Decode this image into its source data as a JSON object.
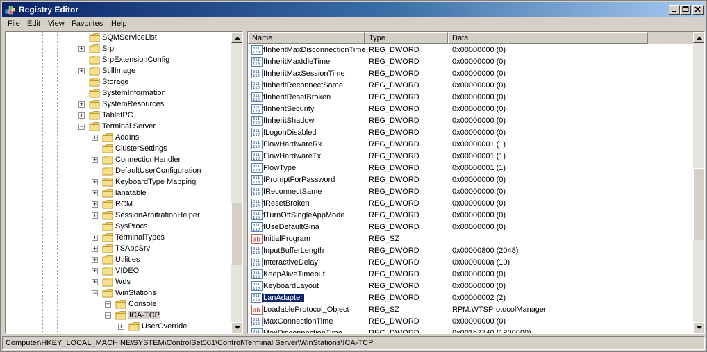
{
  "window": {
    "title": "Registry Editor"
  },
  "menu": [
    "File",
    "Edit",
    "View",
    "Favorites",
    "Help"
  ],
  "tree": [
    {
      "label": "SQMServiceList",
      "level": 0,
      "expander": "none"
    },
    {
      "label": "Srp",
      "level": 0,
      "expander": "plus"
    },
    {
      "label": "SrpExtensionConfig",
      "level": 0,
      "expander": "none"
    },
    {
      "label": "StillImage",
      "level": 0,
      "expander": "plus"
    },
    {
      "label": "Storage",
      "level": 0,
      "expander": "none"
    },
    {
      "label": "SystemInformation",
      "level": 0,
      "expander": "none"
    },
    {
      "label": "SystemResources",
      "level": 0,
      "expander": "plus"
    },
    {
      "label": "TabletPC",
      "level": 0,
      "expander": "plus"
    },
    {
      "label": "Terminal Server",
      "level": 0,
      "expander": "minus"
    },
    {
      "label": "AddIns",
      "level": 1,
      "expander": "plus"
    },
    {
      "label": "ClusterSettings",
      "level": 1,
      "expander": "none"
    },
    {
      "label": "ConnectionHandler",
      "level": 1,
      "expander": "plus"
    },
    {
      "label": "DefaultUserConfiguration",
      "level": 1,
      "expander": "none"
    },
    {
      "label": "KeyboardType Mapping",
      "level": 1,
      "expander": "plus"
    },
    {
      "label": "lanatable",
      "level": 1,
      "expander": "plus"
    },
    {
      "label": "RCM",
      "level": 1,
      "expander": "plus"
    },
    {
      "label": "SessionArbitrationHelper",
      "level": 1,
      "expander": "plus"
    },
    {
      "label": "SysProcs",
      "level": 1,
      "expander": "none"
    },
    {
      "label": "TerminalTypes",
      "level": 1,
      "expander": "plus"
    },
    {
      "label": "TSAppSrv",
      "level": 1,
      "expander": "plus"
    },
    {
      "label": "Utilities",
      "level": 1,
      "expander": "plus"
    },
    {
      "label": "VIDEO",
      "level": 1,
      "expander": "plus"
    },
    {
      "label": "Wds",
      "level": 1,
      "expander": "plus"
    },
    {
      "label": "WinStations",
      "level": 1,
      "expander": "minus"
    },
    {
      "label": "Console",
      "level": 2,
      "expander": "plus"
    },
    {
      "label": "ICA-TCP",
      "level": 2,
      "expander": "minus",
      "selected": true
    },
    {
      "label": "UserOverride",
      "level": 3,
      "expander": "plus"
    }
  ],
  "list": {
    "headers": [
      "Name",
      "Type",
      "Data"
    ],
    "rows": [
      {
        "name": "fInheritMaxDisconnectionTime",
        "type": "REG_DWORD",
        "data": "0x00000000 (0)",
        "icon": "dword"
      },
      {
        "name": "fInheritMaxIdleTime",
        "type": "REG_DWORD",
        "data": "0x00000000 (0)",
        "icon": "dword"
      },
      {
        "name": "fInheritMaxSessionTime",
        "type": "REG_DWORD",
        "data": "0x00000000 (0)",
        "icon": "dword"
      },
      {
        "name": "fInheritReconnectSame",
        "type": "REG_DWORD",
        "data": "0x00000000 (0)",
        "icon": "dword"
      },
      {
        "name": "fInheritResetBroken",
        "type": "REG_DWORD",
        "data": "0x00000000 (0)",
        "icon": "dword"
      },
      {
        "name": "fInheritSecurity",
        "type": "REG_DWORD",
        "data": "0x00000000 (0)",
        "icon": "dword"
      },
      {
        "name": "fInheritShadow",
        "type": "REG_DWORD",
        "data": "0x00000000 (0)",
        "icon": "dword"
      },
      {
        "name": "fLogonDisabled",
        "type": "REG_DWORD",
        "data": "0x00000000 (0)",
        "icon": "dword"
      },
      {
        "name": "FlowHardwareRx",
        "type": "REG_DWORD",
        "data": "0x00000001 (1)",
        "icon": "dword"
      },
      {
        "name": "FlowHardwareTx",
        "type": "REG_DWORD",
        "data": "0x00000001 (1)",
        "icon": "dword"
      },
      {
        "name": "FlowType",
        "type": "REG_DWORD",
        "data": "0x00000001 (1)",
        "icon": "dword"
      },
      {
        "name": "fPromptForPassword",
        "type": "REG_DWORD",
        "data": "0x00000000 (0)",
        "icon": "dword"
      },
      {
        "name": "fReconnectSame",
        "type": "REG_DWORD",
        "data": "0x00000000 (0)",
        "icon": "dword"
      },
      {
        "name": "fResetBroken",
        "type": "REG_DWORD",
        "data": "0x00000000 (0)",
        "icon": "dword"
      },
      {
        "name": "fTurnOffSingleAppMode",
        "type": "REG_DWORD",
        "data": "0x00000000 (0)",
        "icon": "dword"
      },
      {
        "name": "fUseDefaultGina",
        "type": "REG_DWORD",
        "data": "0x00000000 (0)",
        "icon": "dword"
      },
      {
        "name": "InitialProgram",
        "type": "REG_SZ",
        "data": "",
        "icon": "string"
      },
      {
        "name": "InputBufferLength",
        "type": "REG_DWORD",
        "data": "0x00000800 (2048)",
        "icon": "dword"
      },
      {
        "name": "InteractiveDelay",
        "type": "REG_DWORD",
        "data": "0x0000000a (10)",
        "icon": "dword"
      },
      {
        "name": "KeepAliveTimeout",
        "type": "REG_DWORD",
        "data": "0x00000000 (0)",
        "icon": "dword"
      },
      {
        "name": "KeyboardLayout",
        "type": "REG_DWORD",
        "data": "0x00000000 (0)",
        "icon": "dword"
      },
      {
        "name": "LanAdapter",
        "type": "REG_DWORD",
        "data": "0x00000002 (2)",
        "icon": "dword",
        "selected": true
      },
      {
        "name": "LoadableProtocol_Object",
        "type": "REG_SZ",
        "data": "RPM.WTSProtocolManager",
        "icon": "string"
      },
      {
        "name": "MaxConnectionTime",
        "type": "REG_DWORD",
        "data": "0x00000000 (0)",
        "icon": "dword"
      },
      {
        "name": "MaxDisconnectionTime",
        "type": "REG_DWORD",
        "data": "0x001b7740 (1800000)",
        "icon": "dword"
      }
    ]
  },
  "status": {
    "path": "Computer\\HKEY_LOCAL_MACHINE\\SYSTEM\\ControlSet001\\Control\\Terminal Server\\WinStations\\ICA-TCP"
  },
  "icons": {
    "title": "registry-editor-icon",
    "folder": "folder-icon",
    "dword": "binary-value-icon",
    "string": "string-value-icon"
  }
}
